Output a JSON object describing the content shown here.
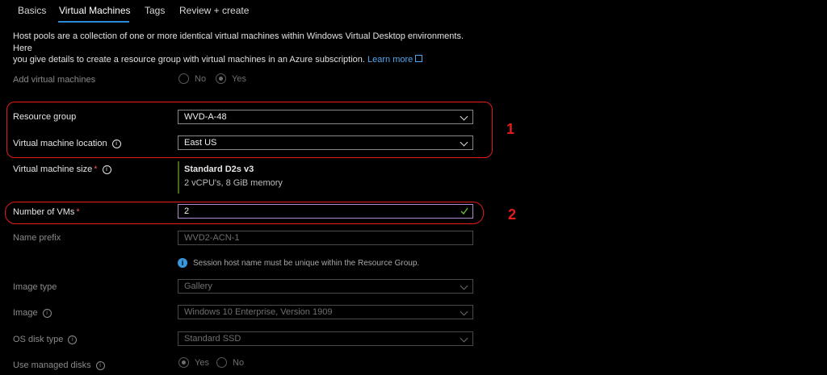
{
  "tabs": [
    "Basics",
    "Virtual Machines",
    "Tags",
    "Review + create"
  ],
  "description": {
    "line1": "Host pools are a collection of one or more identical virtual machines within Windows Virtual Desktop environments. Here",
    "line2": "you give details to create a resource group with virtual machines in an Azure subscription.",
    "link": "Learn more"
  },
  "add_vms": {
    "label": "Add virtual machines",
    "no": "No",
    "yes": "Yes",
    "selected": "Yes"
  },
  "resource_group": {
    "label": "Resource group",
    "value": "WVD-A-48"
  },
  "vm_location": {
    "label": "Virtual machine location",
    "value": "East US"
  },
  "vm_size": {
    "label": "Virtual machine size",
    "required": "*",
    "name": "Standard D2s v3",
    "spec": "2 vCPU's, 8 GiB memory"
  },
  "num_vms": {
    "label": "Number of VMs",
    "required": "*",
    "value": "2"
  },
  "name_prefix": {
    "label": "Name prefix",
    "placeholder": "WVD2-ACN-1"
  },
  "notice": "Session host name must be unique within the Resource Group.",
  "image_type": {
    "label": "Image type",
    "value": "Gallery"
  },
  "image": {
    "label": "Image",
    "value": "Windows 10 Enterprise, Version 1909"
  },
  "os_disk": {
    "label": "OS disk type",
    "value": "Standard SSD"
  },
  "managed_disks": {
    "label": "Use managed disks",
    "yes": "Yes",
    "no": "No",
    "selected": "Yes"
  },
  "annotations": [
    "1",
    "2"
  ],
  "colors": {
    "accent": "#2a8ad4",
    "annotation": "#e41c1c",
    "required": "#e35b5b"
  }
}
